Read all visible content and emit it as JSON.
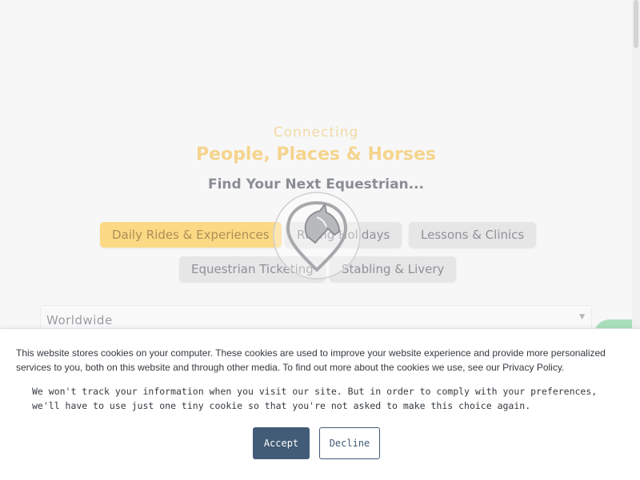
{
  "hero": {
    "tagline": "Connecting",
    "headline": "People, Places & Horses",
    "subhead": "Find Your Next Equestrian...",
    "categories": [
      {
        "label": "Daily Rides & Experiences",
        "active": true
      },
      {
        "label": "Riding Holidays",
        "active": false
      },
      {
        "label": "Lessons & Clinics",
        "active": false
      },
      {
        "label": "Equestrian Ticketing",
        "active": false
      },
      {
        "label": "Stabling & Livery",
        "active": false
      }
    ],
    "logo_icon": "horse-location-pin-icon",
    "region_select": {
      "value": "Worldwide",
      "icon": "dropdown-arrow-icon"
    }
  },
  "chat": {
    "icon": "chat-bubble-icon"
  },
  "cookie_banner": {
    "text_primary": "This website stores cookies on your computer. These cookies are used to improve your website experience and provide more personalized services to you, both on this website and through other media. To find out more about the cookies we use, see our Privacy Policy.",
    "text_secondary": "We won't track your information when you visit our site. But in order to comply with your preferences, we'll have to use just one tiny cookie so that you're not asked to make this choice again.",
    "accept_label": "Accept",
    "decline_label": "Decline"
  },
  "colors": {
    "accent": "#fcd984",
    "cookie_button": "#425b76",
    "chat": "#7fd39a"
  }
}
